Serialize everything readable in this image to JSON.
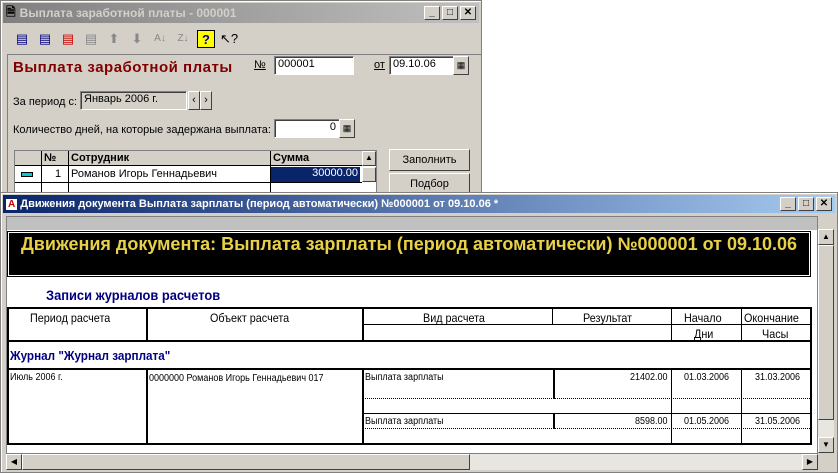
{
  "back_window": {
    "title": "Выплата заработной платы - 000001",
    "toolbar_icons": [
      "new-row-icon",
      "add-row-icon",
      "delete-row-icon",
      "copy-row-icon",
      "move-up-icon",
      "move-down-icon",
      "sort-asc-icon",
      "sort-desc-icon",
      "help-icon",
      "context-help-icon"
    ],
    "heading": "Выплата заработной платы",
    "number_label": "№",
    "number_value": "000001",
    "date_label": "от",
    "date_value": "09.10.06",
    "period_label": "За период с:",
    "period_value": "Январь 2006 г.",
    "delay_label": "Количество дней, на которые задержана выплата:",
    "delay_value": "0",
    "grid": {
      "headers": [
        "№",
        "Сотрудник",
        "Сумма"
      ],
      "rows": [
        {
          "n": "1",
          "employee": "Романов Игорь Геннадьевич",
          "sum": "30000.00"
        }
      ]
    },
    "fill_button": "Заполнить",
    "select_button": "Подбор"
  },
  "front_window": {
    "title": "Движения документа Выплата зарплаты (период автоматически) №000001 от 09.10.06  *",
    "report_title": "Движения документа: Выплата зарплаты (период автоматически) №000001 от 09.10.06",
    "section_title": "Записи журналов расчетов",
    "headers": {
      "period": "Период расчета",
      "object": "Объект расчета",
      "kind": "Вид расчета",
      "result": "Результат",
      "start": "Начало",
      "end": "Окончание",
      "days": "Дни",
      "hours": "Часы"
    },
    "journal": "Журнал \"Журнал зарплата\"",
    "record": {
      "period": "Июль 2006 г.",
      "object": "0000000  Романов  Игорь Геннадьевич 017",
      "lines": [
        {
          "kind": "Выплата зарплаты",
          "result": "21402.00",
          "start": "01.03.2006",
          "end": "31.03.2006"
        },
        {
          "kind": "Выплата зарплаты",
          "result": "8598.00",
          "start": "01.05.2006",
          "end": "31.05.2006"
        }
      ]
    }
  },
  "colors": {
    "heading": "#800000",
    "active_title": "#0a246a",
    "report_title_bg": "#000000",
    "report_title_fg": "#e8d048",
    "section": "#000080"
  }
}
